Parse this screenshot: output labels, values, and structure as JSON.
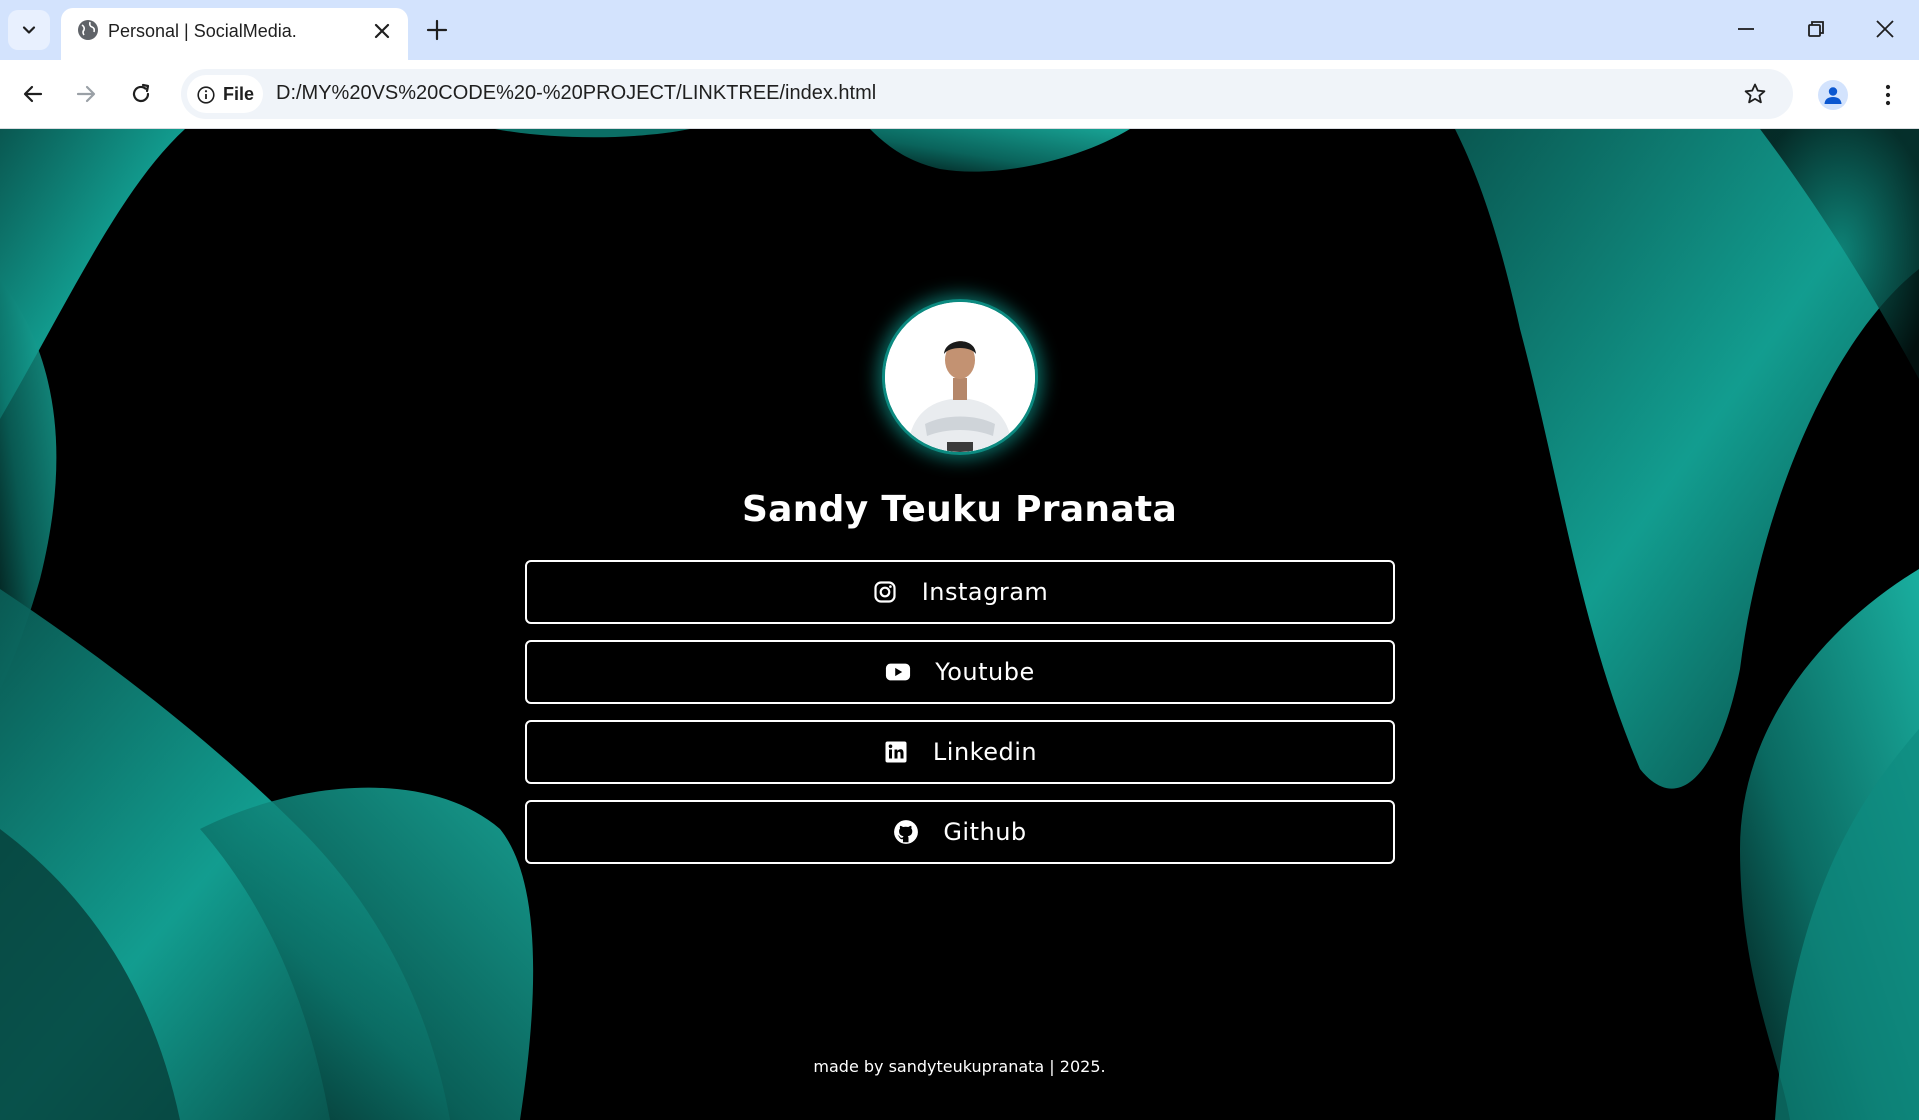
{
  "browser": {
    "tab_title": "Personal | SocialMedia.",
    "security_chip_label": "File",
    "url": "D:/MY%20VS%20CODE%20-%20PROJECT/LINKTREE/index.html"
  },
  "profile": {
    "name": "Sandy Teuku Pranata"
  },
  "links": [
    {
      "label": "Instagram",
      "icon": "instagram-icon"
    },
    {
      "label": "Youtube",
      "icon": "youtube-icon"
    },
    {
      "label": "Linkedin",
      "icon": "linkedin-icon"
    },
    {
      "label": "Github",
      "icon": "github-icon"
    }
  ],
  "footer": {
    "text": "made by sandyteukupranata | 2025."
  },
  "colors": {
    "background": "#000000",
    "accent_teal": "#0fa394",
    "button_border": "#ffffff",
    "tabbar": "#d3e3fd"
  }
}
